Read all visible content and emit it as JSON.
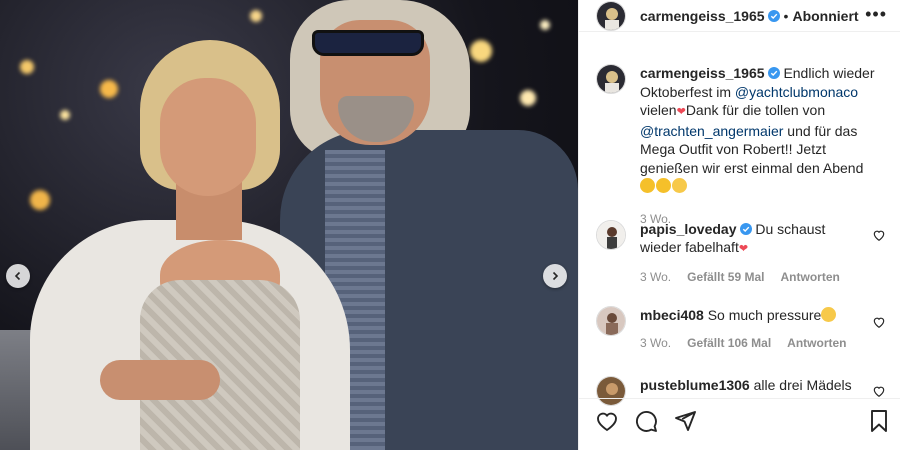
{
  "post": {
    "author": "carmengeiss_1965",
    "follow_status": "Abonniert",
    "separator": "•",
    "more_icon": "more-options-icon"
  },
  "caption": {
    "username": "carmengeiss_1965",
    "part1": "Endlich wieder Oktoberfest im ",
    "mention1": "@yachtclubmonaco",
    "part2": " vielen",
    "part3": "Dank für die tollen von ",
    "mention2": "@trachten_angermaier",
    "part4": " und für das Mega Outfit von Robert!! Jetzt genießen wir erst einmal den Abend ",
    "time": "3 Wo."
  },
  "comments": [
    {
      "username": "papis_loveday",
      "text": "Du schaust wieder fabelhaft",
      "time": "3 Wo.",
      "likes": "Gefällt 59 Mal",
      "reply": "Antworten"
    },
    {
      "username": "mbeci408",
      "text": "So much pressure",
      "time": "3 Wo.",
      "likes": "Gefällt 106 Mal",
      "reply": "Antworten"
    },
    {
      "username": "pusteblume1306",
      "text": "alle drei Mädels"
    }
  ],
  "colors": {
    "link": "#00376b",
    "verified": "#3897f0",
    "text": "#262626",
    "muted": "#8e8e8e",
    "heart": "#ed4956"
  },
  "icons": [
    "like-icon",
    "comment-icon",
    "share-icon",
    "save-icon",
    "verified-badge-icon",
    "chevron-left-icon",
    "chevron-right-icon"
  ]
}
